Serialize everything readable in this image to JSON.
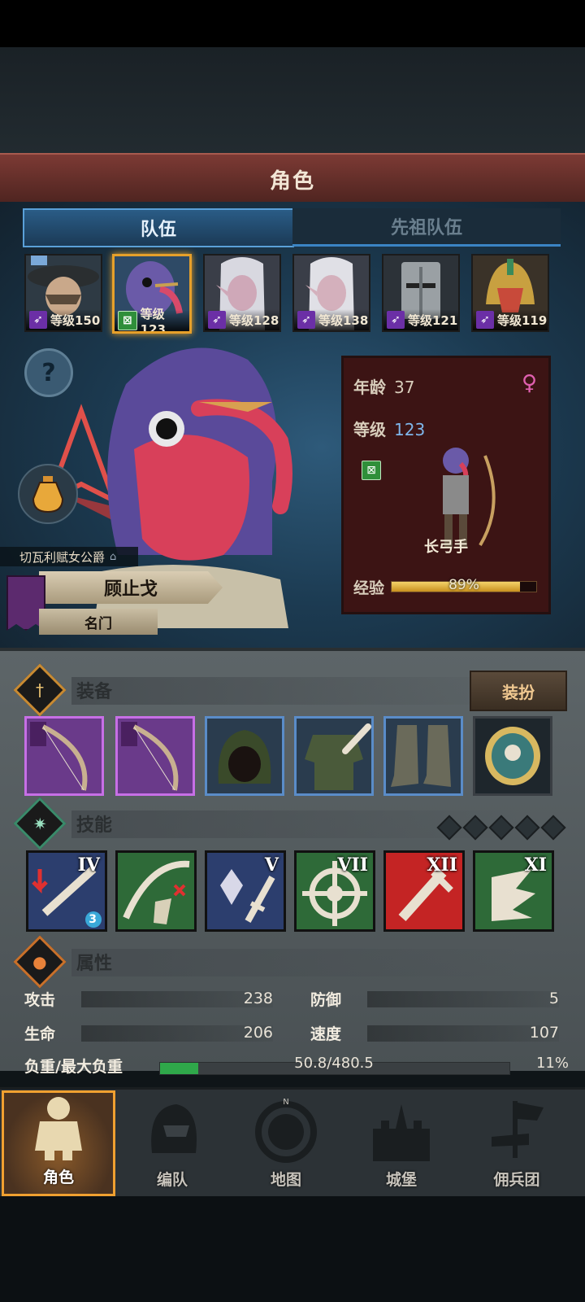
{
  "header": {
    "title": "角色"
  },
  "tabs": [
    {
      "label": "队伍",
      "active": true
    },
    {
      "label": "先祖队伍",
      "active": false
    }
  ],
  "heroes": [
    {
      "class": "purple",
      "level_text": "等级150",
      "selected": false
    },
    {
      "class": "green",
      "level_text": "等级123",
      "selected": true
    },
    {
      "class": "purple",
      "level_text": "等级128",
      "selected": false
    },
    {
      "class": "purple",
      "level_text": "等级138",
      "selected": false
    },
    {
      "class": "purple",
      "level_text": "等级121",
      "selected": false
    },
    {
      "class": "purple",
      "level_text": "等级119",
      "selected": false
    }
  ],
  "character": {
    "title": "切瓦利赋女公爵",
    "name": "顾止戈",
    "clan": "名门",
    "age_label": "年龄",
    "age": "37",
    "level_label": "等级",
    "level": "123",
    "role": "长弓手",
    "exp_label": "经验",
    "exp_text": "89%",
    "exp_progress": 0.89
  },
  "equipment": {
    "title": "装备",
    "dress_button": "装扮",
    "slots": [
      {
        "name": "weapon-slot-1",
        "rarity": "purple",
        "icon": "bow-icon"
      },
      {
        "name": "weapon-slot-2",
        "rarity": "purple",
        "icon": "bow-icon"
      },
      {
        "name": "head-slot",
        "rarity": "blue",
        "icon": "hood-icon"
      },
      {
        "name": "body-slot",
        "rarity": "blue",
        "icon": "tunic-icon"
      },
      {
        "name": "boots-slot",
        "rarity": "blue",
        "icon": "boots-icon"
      },
      {
        "name": "accessory-slot",
        "rarity": "dark",
        "icon": "medallion-icon"
      }
    ]
  },
  "skills": {
    "title": "技能",
    "items": [
      {
        "rank": "IV",
        "color": "#2c3e6e",
        "icon": "sword-debuff-icon",
        "badge": "3"
      },
      {
        "rank": "",
        "color": "#2e6a38",
        "icon": "arrow-cancel-icon",
        "badge": ""
      },
      {
        "rank": "V",
        "color": "#2c3e6e",
        "icon": "crystal-sword-icon",
        "badge": ""
      },
      {
        "rank": "VII",
        "color": "#2e6a38",
        "icon": "target-icon",
        "badge": ""
      },
      {
        "rank": "XII",
        "color": "#c42424",
        "icon": "sword-icon",
        "badge": ""
      },
      {
        "rank": "XI",
        "color": "#2e6a38",
        "icon": "wing-boot-icon",
        "badge": ""
      }
    ]
  },
  "attributes": {
    "title": "属性",
    "attack_label": "攻击",
    "attack": "238",
    "defense_label": "防御",
    "defense": "5",
    "hp_label": "生命",
    "hp": "206",
    "speed_label": "速度",
    "speed": "107",
    "load_label": "负重/最大负重",
    "load_text": "50.8/480.5",
    "load_pct": "11%",
    "load_progress": 0.11
  },
  "nav": [
    {
      "label": "角色",
      "icon": "knight-icon",
      "active": true
    },
    {
      "label": "编队",
      "icon": "helmet-icon",
      "active": false
    },
    {
      "label": "地图",
      "icon": "compass-icon",
      "active": false
    },
    {
      "label": "城堡",
      "icon": "castle-icon",
      "active": false
    },
    {
      "label": "佣兵团",
      "icon": "banner-hand-icon",
      "active": false
    }
  ],
  "colors": {
    "accent": "#e6a02a",
    "card": "#3c1414",
    "load_fill": "#2fa84a",
    "exp_fill": "#e0b040"
  }
}
